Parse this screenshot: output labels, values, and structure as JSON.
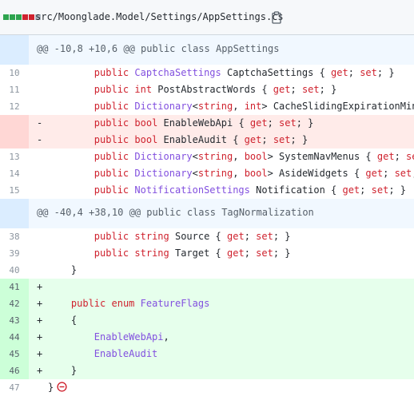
{
  "file": {
    "path": "src/Moonglade.Model/Settings/AppSettings.cs",
    "diffstat_colors": [
      "#2da44e",
      "#2da44e",
      "#2da44e",
      "#cf222e",
      "#cf222e",
      "#afb8c1"
    ],
    "copy_icon": "clipboard-icon"
  },
  "hunks": [
    {
      "header": "@@ -10,8 +10,6 @@ public class AppSettings",
      "lines": [
        {
          "type": "ctx",
          "num": "10",
          "sign": "",
          "tokens": [
            {
              "t": "        "
            },
            {
              "t": "public",
              "c": "kw"
            },
            {
              "t": " "
            },
            {
              "t": "CaptchaSettings",
              "c": "ty"
            },
            {
              "t": " CaptchaSettings { "
            },
            {
              "t": "get",
              "c": "kw"
            },
            {
              "t": "; "
            },
            {
              "t": "set",
              "c": "kw"
            },
            {
              "t": "; }"
            }
          ]
        },
        {
          "type": "ctx",
          "num": "11",
          "sign": "",
          "tokens": [
            {
              "t": "        "
            },
            {
              "t": "public",
              "c": "kw"
            },
            {
              "t": " "
            },
            {
              "t": "int",
              "c": "kw"
            },
            {
              "t": " PostAbstractWords { "
            },
            {
              "t": "get",
              "c": "kw"
            },
            {
              "t": "; "
            },
            {
              "t": "set",
              "c": "kw"
            },
            {
              "t": "; }"
            }
          ]
        },
        {
          "type": "ctx",
          "num": "12",
          "sign": "",
          "tokens": [
            {
              "t": "        "
            },
            {
              "t": "public",
              "c": "kw"
            },
            {
              "t": " "
            },
            {
              "t": "Dictionary",
              "c": "ty"
            },
            {
              "t": "<"
            },
            {
              "t": "string",
              "c": "kw"
            },
            {
              "t": ", "
            },
            {
              "t": "int",
              "c": "kw"
            },
            {
              "t": "> CacheSlidingExpirationMinutes {"
            }
          ]
        },
        {
          "type": "del",
          "num": "",
          "sign": "-",
          "tokens": [
            {
              "t": "        "
            },
            {
              "t": "public",
              "c": "kw"
            },
            {
              "t": " "
            },
            {
              "t": "bool",
              "c": "kw"
            },
            {
              "t": " EnableWebApi { "
            },
            {
              "t": "get",
              "c": "kw"
            },
            {
              "t": "; "
            },
            {
              "t": "set",
              "c": "kw"
            },
            {
              "t": "; }"
            }
          ]
        },
        {
          "type": "del",
          "num": "",
          "sign": "-",
          "tokens": [
            {
              "t": "        "
            },
            {
              "t": "public",
              "c": "kw"
            },
            {
              "t": " "
            },
            {
              "t": "bool",
              "c": "kw"
            },
            {
              "t": " EnableAudit { "
            },
            {
              "t": "get",
              "c": "kw"
            },
            {
              "t": "; "
            },
            {
              "t": "set",
              "c": "kw"
            },
            {
              "t": "; }"
            }
          ]
        },
        {
          "type": "ctx",
          "num": "13",
          "sign": "",
          "tokens": [
            {
              "t": "        "
            },
            {
              "t": "public",
              "c": "kw"
            },
            {
              "t": " "
            },
            {
              "t": "Dictionary",
              "c": "ty"
            },
            {
              "t": "<"
            },
            {
              "t": "string",
              "c": "kw"
            },
            {
              "t": ", "
            },
            {
              "t": "bool",
              "c": "kw"
            },
            {
              "t": "> SystemNavMenus { "
            },
            {
              "t": "get",
              "c": "kw"
            },
            {
              "t": "; "
            },
            {
              "t": "set",
              "c": "kw"
            },
            {
              "t": "; }"
            }
          ]
        },
        {
          "type": "ctx",
          "num": "14",
          "sign": "",
          "tokens": [
            {
              "t": "        "
            },
            {
              "t": "public",
              "c": "kw"
            },
            {
              "t": " "
            },
            {
              "t": "Dictionary",
              "c": "ty"
            },
            {
              "t": "<"
            },
            {
              "t": "string",
              "c": "kw"
            },
            {
              "t": ", "
            },
            {
              "t": "bool",
              "c": "kw"
            },
            {
              "t": "> AsideWidgets { "
            },
            {
              "t": "get",
              "c": "kw"
            },
            {
              "t": "; "
            },
            {
              "t": "set",
              "c": "kw"
            },
            {
              "t": "; }"
            }
          ]
        },
        {
          "type": "ctx",
          "num": "15",
          "sign": "",
          "tokens": [
            {
              "t": "        "
            },
            {
              "t": "public",
              "c": "kw"
            },
            {
              "t": " "
            },
            {
              "t": "NotificationSettings",
              "c": "ty"
            },
            {
              "t": " Notification { "
            },
            {
              "t": "get",
              "c": "kw"
            },
            {
              "t": "; "
            },
            {
              "t": "set",
              "c": "kw"
            },
            {
              "t": "; }"
            }
          ]
        }
      ]
    },
    {
      "header": "@@ -40,4 +38,10 @@ public class TagNormalization",
      "lines": [
        {
          "type": "ctx",
          "num": "38",
          "sign": "",
          "tokens": [
            {
              "t": "        "
            },
            {
              "t": "public",
              "c": "kw"
            },
            {
              "t": " "
            },
            {
              "t": "string",
              "c": "kw"
            },
            {
              "t": " Source { "
            },
            {
              "t": "get",
              "c": "kw"
            },
            {
              "t": "; "
            },
            {
              "t": "set",
              "c": "kw"
            },
            {
              "t": "; }"
            }
          ]
        },
        {
          "type": "ctx",
          "num": "39",
          "sign": "",
          "tokens": [
            {
              "t": "        "
            },
            {
              "t": "public",
              "c": "kw"
            },
            {
              "t": " "
            },
            {
              "t": "string",
              "c": "kw"
            },
            {
              "t": " Target { "
            },
            {
              "t": "get",
              "c": "kw"
            },
            {
              "t": "; "
            },
            {
              "t": "set",
              "c": "kw"
            },
            {
              "t": "; }"
            }
          ]
        },
        {
          "type": "ctx",
          "num": "40",
          "sign": "",
          "tokens": [
            {
              "t": "    }"
            }
          ]
        },
        {
          "type": "add",
          "num": "41",
          "sign": "+",
          "tokens": []
        },
        {
          "type": "add",
          "num": "42",
          "sign": "+",
          "tokens": [
            {
              "t": "    "
            },
            {
              "t": "public",
              "c": "kw"
            },
            {
              "t": " "
            },
            {
              "t": "enum",
              "c": "kw"
            },
            {
              "t": " "
            },
            {
              "t": "FeatureFlags",
              "c": "ty"
            }
          ]
        },
        {
          "type": "add",
          "num": "43",
          "sign": "+",
          "tokens": [
            {
              "t": "    {"
            }
          ]
        },
        {
          "type": "add",
          "num": "44",
          "sign": "+",
          "tokens": [
            {
              "t": "        "
            },
            {
              "t": "EnableWebApi",
              "c": "ty"
            },
            {
              "t": ","
            }
          ]
        },
        {
          "type": "add",
          "num": "45",
          "sign": "+",
          "tokens": [
            {
              "t": "        "
            },
            {
              "t": "EnableAudit",
              "c": "ty"
            }
          ]
        },
        {
          "type": "add",
          "num": "46",
          "sign": "+",
          "tokens": [
            {
              "t": "    }"
            }
          ]
        },
        {
          "type": "ctx",
          "num": "47",
          "sign": "",
          "tokens": [
            {
              "t": "}"
            }
          ],
          "no_newline_icon": "no-newline-icon"
        }
      ]
    }
  ]
}
